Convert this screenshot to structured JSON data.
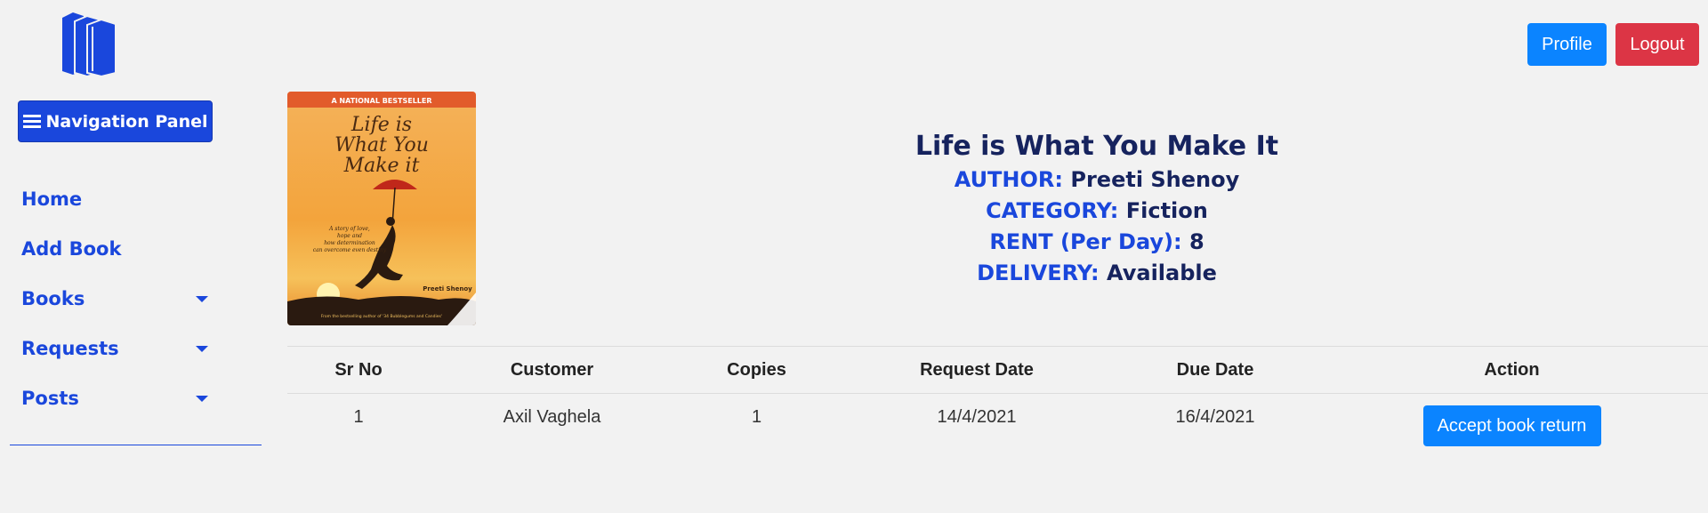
{
  "header": {
    "profile_label": "Profile",
    "logout_label": "Logout"
  },
  "sidebar": {
    "toggle_label": "Navigation Panel",
    "items": [
      {
        "label": "Home",
        "has_dropdown": false
      },
      {
        "label": "Add Book",
        "has_dropdown": false
      },
      {
        "label": "Books",
        "has_dropdown": true
      },
      {
        "label": "Requests",
        "has_dropdown": true
      },
      {
        "label": "Posts",
        "has_dropdown": true
      }
    ]
  },
  "book": {
    "title": "Life is What You Make It",
    "author_label": "AUTHOR:",
    "author": "Preeti Shenoy",
    "category_label": "CATEGORY:",
    "category": "Fiction",
    "rent_label": "RENT (Per Day):",
    "rent": "8",
    "delivery_label": "DELIVERY:",
    "delivery": "Available",
    "cover": {
      "banner": "A NATIONAL BESTSELLER",
      "title_lines": [
        "Life is",
        "What You",
        "Make it"
      ],
      "tagline_lines": [
        "A story of love,",
        "hope and",
        "how determination",
        "can overcome even destiny"
      ],
      "author": "Preeti Shenoy",
      "footer": "From the bestselling author of '34 Bubblegums and Candies'"
    }
  },
  "table": {
    "headers": [
      "Sr No",
      "Customer",
      "Copies",
      "Request Date",
      "Due Date",
      "Action"
    ],
    "rows": [
      {
        "sr": "1",
        "customer": "Axil Vaghela",
        "copies": "1",
        "request_date": "14/4/2021",
        "due_date": "16/4/2021",
        "action": "Accept book return"
      }
    ]
  },
  "colors": {
    "primary": "#1a47dc",
    "button_blue": "#0b84ff",
    "danger": "#dc3545",
    "navy": "#16235e",
    "background": "#f2f2f2"
  },
  "icons": [
    "books-logo-icon",
    "bars-icon",
    "caret-down-icon"
  ]
}
